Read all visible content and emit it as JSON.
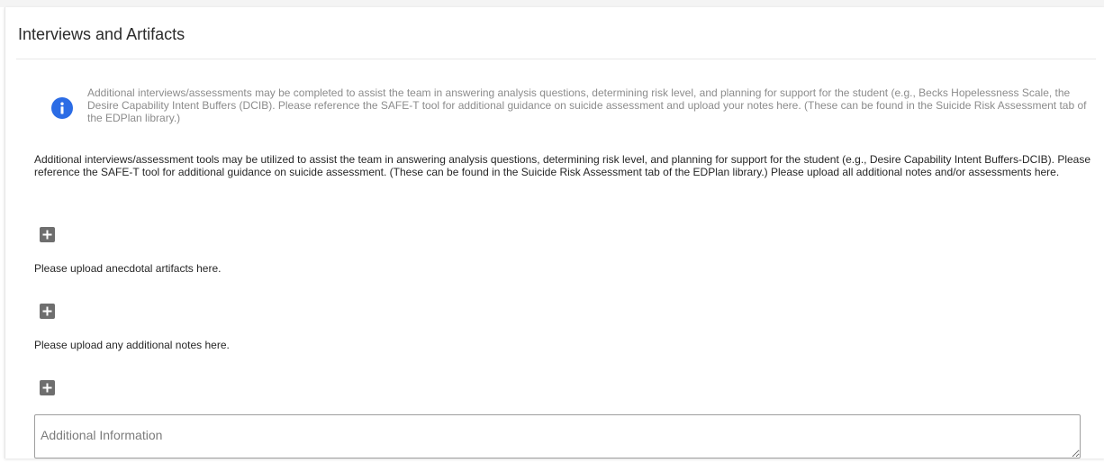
{
  "section": {
    "title": "Interviews and Artifacts"
  },
  "info_callout": {
    "icon": "info-icon",
    "icon_color": "#2b6ce5",
    "text": "Additional interviews/assessments may be completed to assist the team in answering analysis questions, determining risk level, and planning for support for the student (e.g., Becks Hopelessness Scale, the Desire Capability Intent Buffers (DCIB). Please reference the SAFE-T tool for additional guidance on suicide assessment and upload your notes here. (These can be found in the Suicide Risk Assessment tab of the EDPlan library.)"
  },
  "uploads": [
    {
      "description": "Additional interviews/assessment tools may be utilized to assist the team in answering analysis questions, determining risk level, and planning for support for the student (e.g., Desire Capability Intent Buffers-DCIB). Please reference the SAFE-T tool for additional guidance on suicide assessment. (These can be found in the Suicide Risk Assessment tab of the EDPlan library.) Please upload all additional notes and/or assessments here.",
      "add_icon": "plus-icon"
    },
    {
      "description": "Please upload anecdotal artifacts here.",
      "add_icon": "plus-icon"
    },
    {
      "description": "Please upload any additional notes here.",
      "add_icon": "plus-icon"
    }
  ],
  "additional_info": {
    "placeholder": "Additional Information",
    "value": ""
  }
}
